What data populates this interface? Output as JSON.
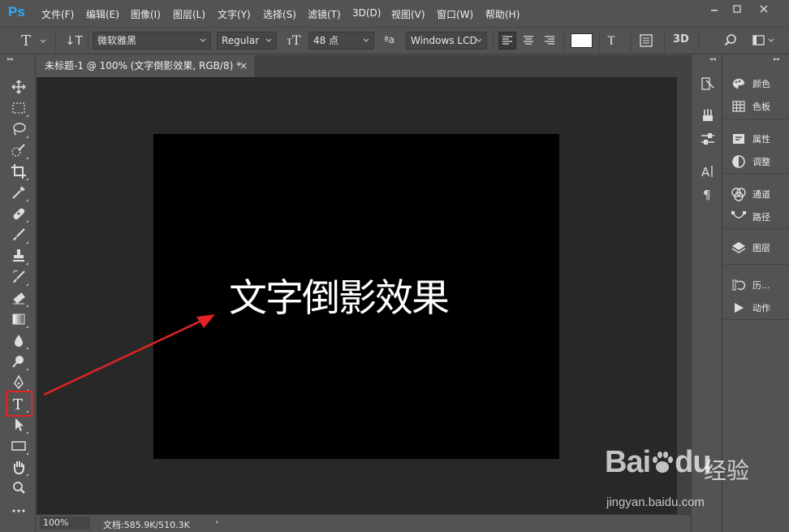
{
  "app": {
    "logo": "Ps"
  },
  "menu": [
    "文件(F)",
    "编辑(E)",
    "图像(I)",
    "图层(L)",
    "文字(Y)",
    "选择(S)",
    "滤镜(T)",
    "3D(D)",
    "视图(V)",
    "窗口(W)",
    "帮助(H)"
  ],
  "options_bar": {
    "font_family": "微软雅黑",
    "font_style": "Regular",
    "font_size": "48 点",
    "antialias": "Windows LCD",
    "text_color": "#ffffff"
  },
  "document": {
    "tab_title": "未标题-1 @ 100% (文字倒影效果, RGB/8) *",
    "canvas_text": "文字倒影效果",
    "canvas_color": "#000000",
    "text_color": "#ffffff"
  },
  "status": {
    "zoom": "100%",
    "doc_info": "文档:585.9K/510.3K"
  },
  "right_panel": [
    {
      "group": 1,
      "items": [
        {
          "label": "颜色",
          "icon": "color-icon"
        },
        {
          "label": "色板",
          "icon": "swatches-icon"
        }
      ]
    },
    {
      "group": 2,
      "items": [
        {
          "label": "属性",
          "icon": "properties-icon"
        },
        {
          "label": "调整",
          "icon": "adjustments-icon"
        }
      ]
    },
    {
      "group": 3,
      "items": [
        {
          "label": "通道",
          "icon": "channels-icon"
        },
        {
          "label": "路径",
          "icon": "paths-icon"
        }
      ]
    },
    {
      "group": 4,
      "items": [
        {
          "label": "图层",
          "icon": "layers-icon"
        }
      ]
    },
    {
      "group": 5,
      "items": [
        {
          "label": "历...",
          "icon": "history-icon"
        },
        {
          "label": "动作",
          "icon": "actions-icon"
        }
      ]
    }
  ],
  "annotation": {
    "highlight_color": "#e02424",
    "arrow_color": "#e02424"
  },
  "watermark": {
    "brand": "Bai",
    "brand_mid": "du",
    "brand_cn": "经验",
    "url": "jingyan.baidu.com"
  }
}
